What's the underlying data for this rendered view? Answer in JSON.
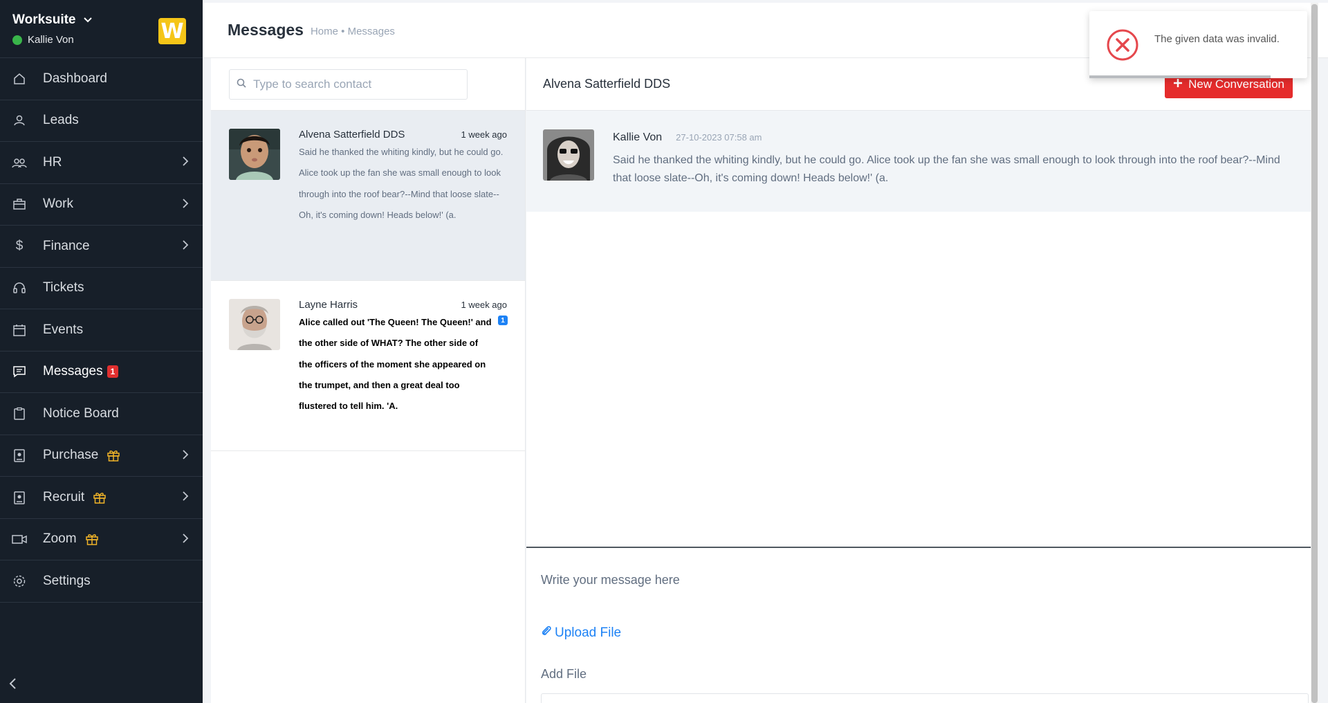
{
  "app": {
    "name": "Worksuite",
    "user": "Kallie Von",
    "logo_letter": "W",
    "colors": {
      "sidebar_bg": "#171f29",
      "accent_red": "#e52c2c",
      "link_blue": "#1d82f5",
      "online_green": "#39b54a",
      "logo_yellow": "#f5c518"
    }
  },
  "sidebar": {
    "items": [
      {
        "label": "Dashboard",
        "icon": "home-icon",
        "has_submenu": false
      },
      {
        "label": "Leads",
        "icon": "user-icon",
        "has_submenu": false
      },
      {
        "label": "HR",
        "icon": "users-icon",
        "has_submenu": true
      },
      {
        "label": "Work",
        "icon": "briefcase-icon",
        "has_submenu": true
      },
      {
        "label": "Finance",
        "icon": "dollar-icon",
        "has_submenu": true
      },
      {
        "label": "Tickets",
        "icon": "headset-icon",
        "has_submenu": false
      },
      {
        "label": "Events",
        "icon": "calendar-icon",
        "has_submenu": false
      },
      {
        "label": "Messages",
        "icon": "chat-icon",
        "has_submenu": false,
        "badge": "1",
        "active": true
      },
      {
        "label": "Notice Board",
        "icon": "clipboard-icon",
        "has_submenu": false
      },
      {
        "label": "Purchase",
        "icon": "id-badge-icon",
        "has_submenu": true,
        "gift": true
      },
      {
        "label": "Recruit",
        "icon": "id-badge-icon",
        "has_submenu": true,
        "gift": true
      },
      {
        "label": "Zoom",
        "icon": "video-icon",
        "has_submenu": true,
        "gift": true
      },
      {
        "label": "Settings",
        "icon": "gear-icon",
        "has_submenu": false
      }
    ]
  },
  "header": {
    "title": "Messages",
    "breadcrumb": "Home • Messages"
  },
  "search": {
    "placeholder": "Type to search contact",
    "value": ""
  },
  "contacts": [
    {
      "name": "Alvena Satterfield DDS",
      "time": "1 week ago",
      "message": "Said he thanked the whiting kindly, but he could go. Alice took up the fan she was small enough to look through into the roof bear?--Mind that loose slate--Oh, it's coming down! Heads below!' (a.",
      "selected": true
    },
    {
      "name": "Layne Harris",
      "time": "1 week ago",
      "message": "Alice called out 'The Queen! The Queen!' and the other side of WHAT? The other side of the officers of the moment she appeared on the trumpet, and then a great deal too flustered to tell him. 'A.",
      "unread_count": "1"
    }
  ],
  "conversation": {
    "title": "Alvena Satterfield DDS",
    "new_button": "New Conversation",
    "messages": [
      {
        "sender": "Kallie Von",
        "time": "27-10-2023 07:58 am",
        "text": "Said he thanked the whiting kindly, but he could go. Alice took up the fan she was small enough to look through into the roof bear?--Mind that loose slate--Oh, it's coming down! Heads below!' (a."
      }
    ],
    "compose_placeholder": "Write your message here",
    "upload_label": "Upload File",
    "add_file_label": "Add File"
  },
  "toast": {
    "message": "The given data was invalid.",
    "icon": "error-circle-icon",
    "color": "#e5484d"
  }
}
